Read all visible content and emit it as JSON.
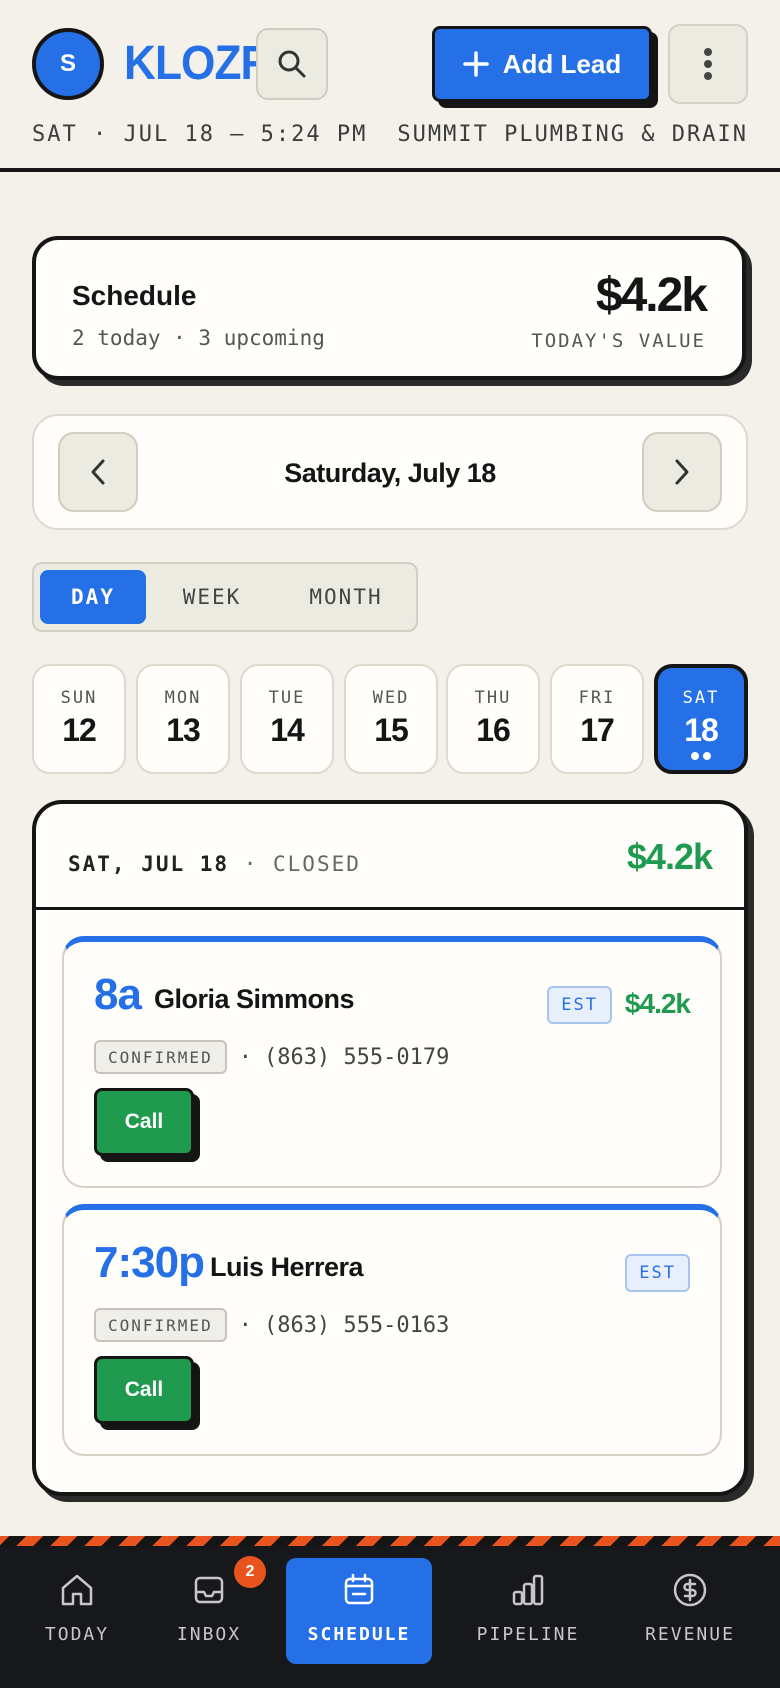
{
  "header": {
    "avatar_initial": "S",
    "brand": "KLOZR",
    "add_lead_label": "Add Lead",
    "datetime": "SAT · JUL 18 — 5:24 PM",
    "company": "SUMMIT PLUMBING & DRAIN"
  },
  "summary": {
    "title": "Schedule",
    "subtitle": "2 today · 3 upcoming",
    "value": "$4.2k",
    "value_label": "TODAY'S VALUE"
  },
  "date_nav": {
    "label": "Saturday, July 18"
  },
  "view_toggle": {
    "items": [
      "DAY",
      "WEEK",
      "MONTH"
    ],
    "active": "DAY"
  },
  "days": [
    {
      "name": "SUN",
      "num": "12"
    },
    {
      "name": "MON",
      "num": "13"
    },
    {
      "name": "TUE",
      "num": "14"
    },
    {
      "name": "WED",
      "num": "15"
    },
    {
      "name": "THU",
      "num": "16"
    },
    {
      "name": "FRI",
      "num": "17"
    },
    {
      "name": "SAT",
      "num": "18",
      "active": true
    }
  ],
  "panel": {
    "date": "SAT, JUL 18",
    "status": "· CLOSED",
    "total": "$4.2k"
  },
  "appointments": [
    {
      "time": "8a",
      "name": "Gloria Simmons",
      "tag": "EST",
      "value": "$4.2k",
      "status": "CONFIRMED",
      "phone": "(863) 555-0179",
      "call_label": "Call"
    },
    {
      "time": "7:30p",
      "name": "Luis Herrera",
      "tag": "EST",
      "value": "",
      "status": "CONFIRMED",
      "phone": "(863) 555-0163",
      "call_label": "Call"
    }
  ],
  "bottom_nav": {
    "items": [
      "TODAY",
      "INBOX",
      "SCHEDULE",
      "PIPELINE",
      "REVENUE"
    ],
    "active": "SCHEDULE",
    "inbox_badge": "2"
  },
  "colors": {
    "accent": "#2570e6",
    "success": "#1f9a4f",
    "warning": "#e8531e",
    "background": "#f3f1ea",
    "ink": "#151515"
  },
  "icons": {
    "search": "search-icon",
    "add": "plus-icon",
    "more": "more-vertical-icon",
    "prev": "chevron-left-icon",
    "next": "chevron-right-icon",
    "today": "home-icon",
    "inbox": "inbox-icon",
    "schedule": "calendar-icon",
    "pipeline": "bar-chart-icon",
    "revenue": "dollar-icon"
  }
}
